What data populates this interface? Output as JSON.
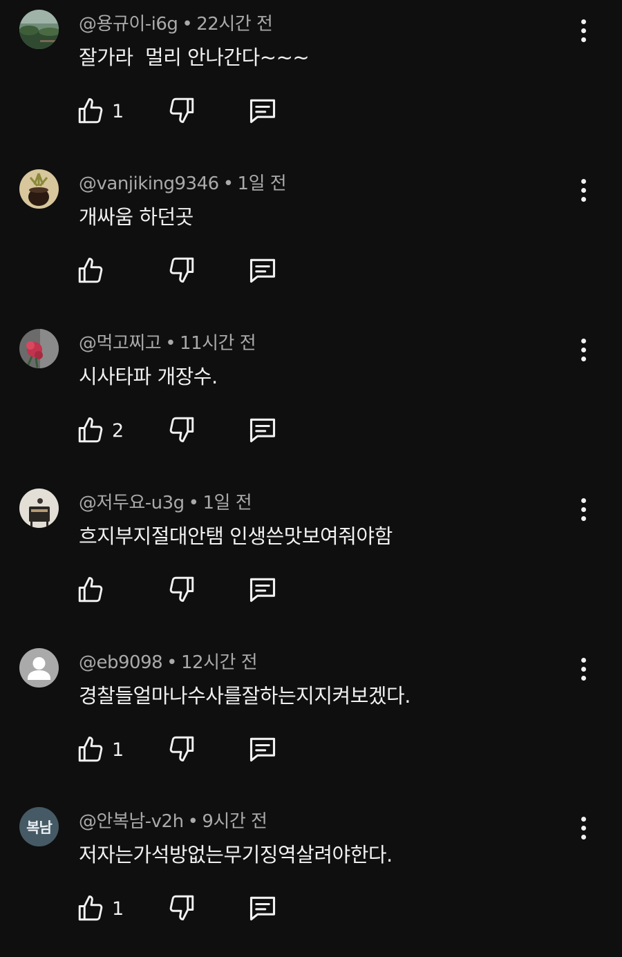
{
  "comments": [
    {
      "author": "@용규이-i6g",
      "time": "22시간 전",
      "text": "잘가라  멀리 안나간다~~~",
      "likes": "1",
      "avatar": {
        "type": "image",
        "icon": "landscape-photo-avatar",
        "colors": [
          "#5a7a5a",
          "#2e4a2e",
          "#9bb0a0"
        ]
      }
    },
    {
      "author": "@vanjiking9346",
      "time": "1일 전",
      "text": "개싸움 하던곳",
      "likes": "",
      "avatar": {
        "type": "image",
        "icon": "plant-pot-photo-avatar",
        "colors": [
          "#d9c79a",
          "#2a1a12",
          "#7a6a3a"
        ]
      }
    },
    {
      "author": "@먹고찌고",
      "time": "11시간 전",
      "text": "시사타파 개장수.",
      "likes": "2",
      "avatar": {
        "type": "image",
        "icon": "flower-photo-avatar",
        "colors": [
          "#6a6a6a",
          "#c2334d",
          "#3a5a3a"
        ]
      }
    },
    {
      "author": "@저두요-u3g",
      "time": "1일 전",
      "text": "흐지부지절대안탬 인생쓴맛보여줘야함",
      "likes": "",
      "avatar": {
        "type": "image",
        "icon": "room-photo-avatar",
        "colors": [
          "#e6e1d8",
          "#2a2622",
          "#b59a74"
        ]
      }
    },
    {
      "author": "@eb9098",
      "time": "12시간 전",
      "text": "경찰들얼마나수사를잘하는지지켜보겠다.",
      "likes": "1",
      "avatar": {
        "type": "default",
        "icon": "person-icon",
        "colors": [
          "#aaaaaa",
          "#ffffff"
        ]
      }
    },
    {
      "author": "@안복남-v2h",
      "time": "9시간 전",
      "text": "저자는가석방없는무기징역살려야한다.",
      "likes": "1",
      "avatar": {
        "type": "initials",
        "initials": "복남",
        "colors": [
          "#455a64"
        ]
      }
    }
  ],
  "theme": {
    "background": "#0f0f0f",
    "text": "#f1f1f1",
    "secondary_text": "#aaaaaa"
  },
  "meta_separator": "•"
}
